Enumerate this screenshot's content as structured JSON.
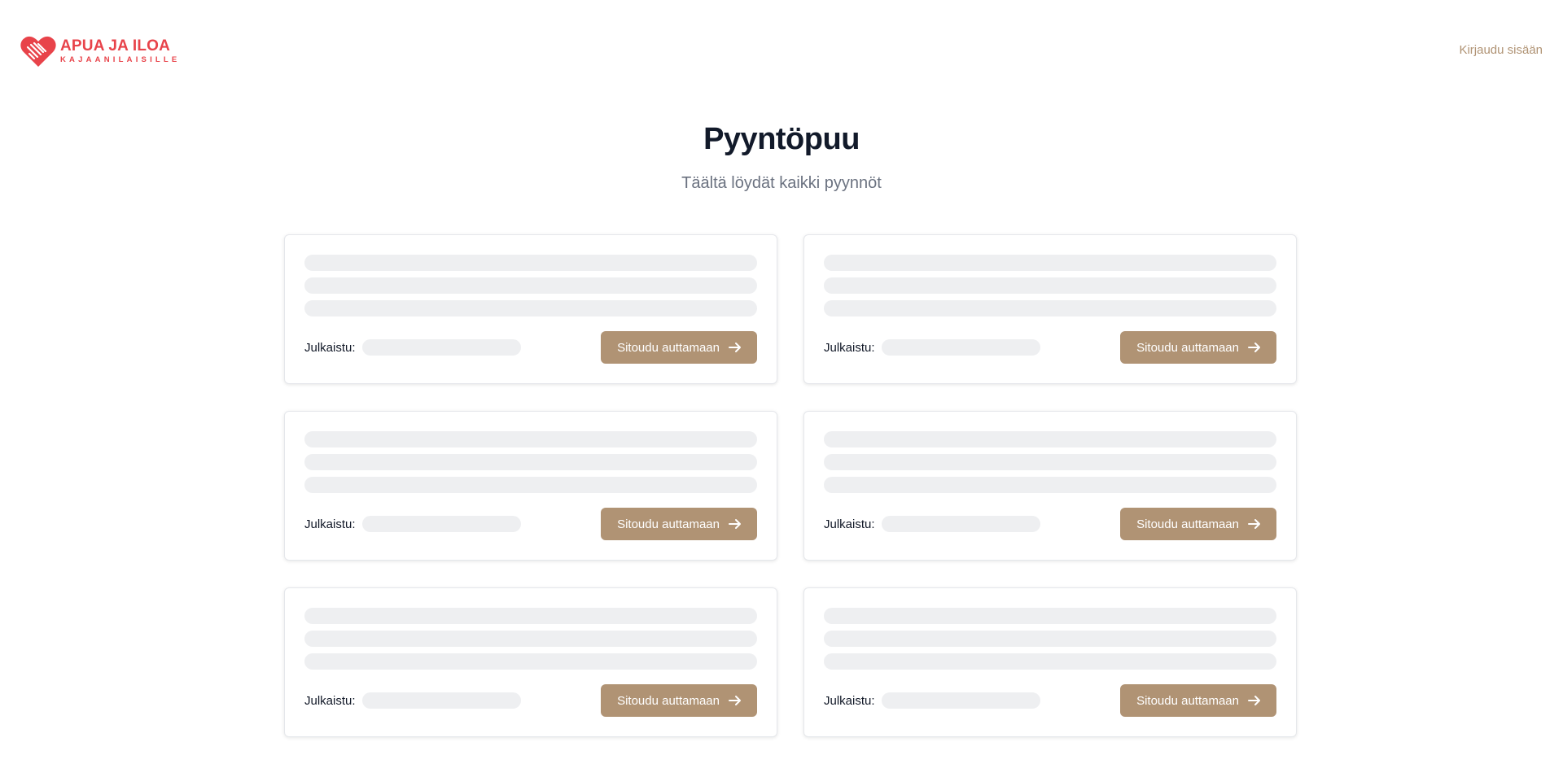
{
  "header": {
    "logo_title": "APUA JA ILOA",
    "logo_subtitle": "KAJAANILAISILLE",
    "login_label": "Kirjaudu sisään",
    "logo_icon": "heart-hands-icon"
  },
  "main": {
    "title": "Pyyntöpuu",
    "subtitle": "Täältä löydät kaikki pyynnöt"
  },
  "cards": [
    {
      "published_label": "Julkaistu:",
      "button_label": "Sitoudu auttamaan"
    },
    {
      "published_label": "Julkaistu:",
      "button_label": "Sitoudu auttamaan"
    },
    {
      "published_label": "Julkaistu:",
      "button_label": "Sitoudu auttamaan"
    },
    {
      "published_label": "Julkaistu:",
      "button_label": "Sitoudu auttamaan"
    },
    {
      "published_label": "Julkaistu:",
      "button_label": "Sitoudu auttamaan"
    },
    {
      "published_label": "Julkaistu:",
      "button_label": "Sitoudu auttamaan"
    }
  ],
  "colors": {
    "brand_red": "#e8434a",
    "accent": "#b09374",
    "title": "#121a2a",
    "skeleton": "#eeeff1"
  }
}
